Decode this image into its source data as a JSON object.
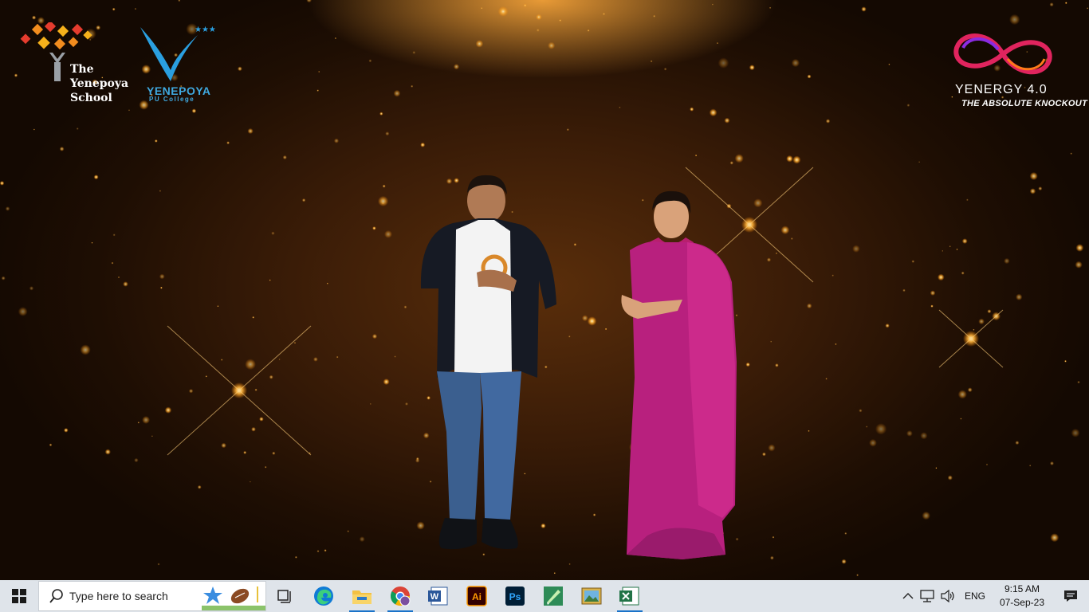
{
  "logos": {
    "school": {
      "line1": "The",
      "line2": "Yenepoya",
      "line3": "School"
    },
    "pu_college": {
      "name": "YENEPOYA",
      "sub": "PU College"
    },
    "event": {
      "title": "YENERGY 4.0",
      "subtitle": "THE ABSOLUTE KNOCKOUT"
    }
  },
  "taskbar": {
    "search_placeholder": "Type here to search",
    "pinned": [
      {
        "name": "task-view-icon"
      },
      {
        "name": "edge-icon"
      },
      {
        "name": "file-explorer-icon"
      },
      {
        "name": "chrome-icon"
      },
      {
        "name": "word-icon",
        "label": "W"
      },
      {
        "name": "illustrator-icon",
        "label": "Ai"
      },
      {
        "name": "photoshop-icon",
        "label": "Ps"
      },
      {
        "name": "pen-app-icon"
      },
      {
        "name": "photos-icon"
      },
      {
        "name": "excel-icon"
      }
    ],
    "language": "ENG",
    "time": "9:15 AM",
    "date": "07-Sep-23"
  },
  "colors": {
    "taskbar": "#dfe4ea",
    "accent": "#1a73c9",
    "background": "#3a1c07",
    "saree": "#b8207e"
  }
}
